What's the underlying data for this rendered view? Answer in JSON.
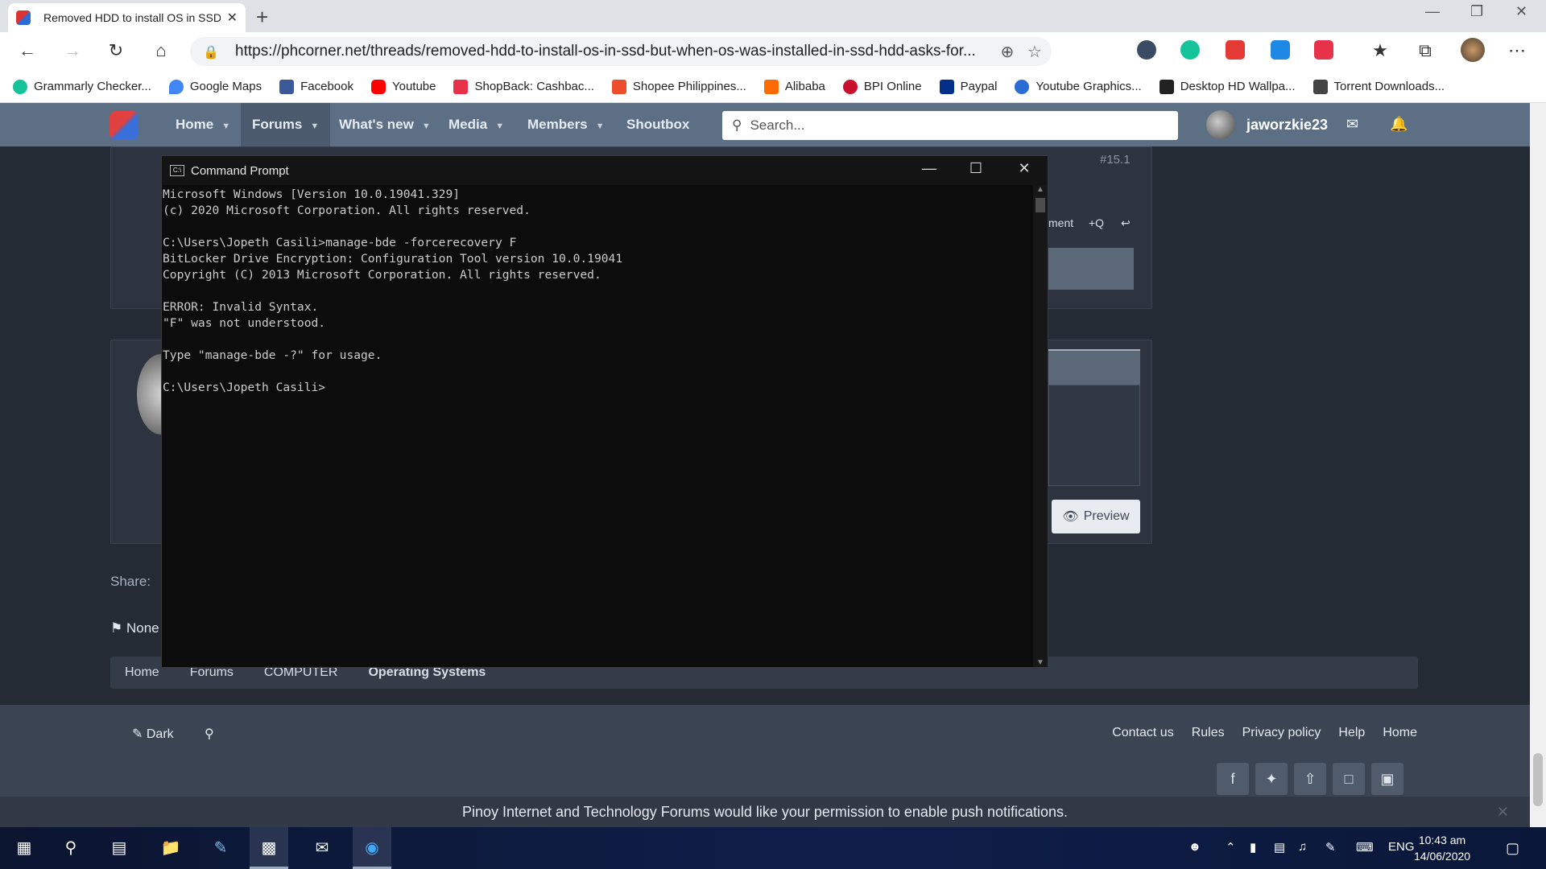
{
  "browser": {
    "tab_title": "Removed HDD to install OS in SSD but when OS was installed in SSD HDD asks for...",
    "tab_close": "✕",
    "new_tab": "+",
    "url": "https://phcorner.net/threads/removed-hdd-to-install-os-in-ssd-but-when-os-was-installed-in-ssd-hdd-asks-for...",
    "bookmarks": [
      {
        "label": "Grammarly Checker...",
        "color": "#15c39a"
      },
      {
        "label": "Google Maps",
        "color": "#4285f4"
      },
      {
        "label": "Facebook",
        "color": "#3b5998"
      },
      {
        "label": "Youtube",
        "color": "#ff0000"
      },
      {
        "label": "ShopBack: Cashbac...",
        "color": "#e8324a"
      },
      {
        "label": "Shopee Philippines...",
        "color": "#ee4d2d"
      },
      {
        "label": "Alibaba",
        "color": "#ff6a00"
      },
      {
        "label": "BPI Online",
        "color": "#c8102e"
      },
      {
        "label": "Paypal",
        "color": "#003087"
      },
      {
        "label": "Youtube Graphics...",
        "color": "#2b6cd4"
      },
      {
        "label": "Desktop HD Wallpa...",
        "color": "#222222"
      },
      {
        "label": "Torrent Downloads...",
        "color": "#444444"
      }
    ]
  },
  "site": {
    "nav": [
      "Home",
      "Forums",
      "What's new",
      "Media",
      "Members",
      "Shoutbox"
    ],
    "search_placeholder": "Search...",
    "username": "jaworzkie23",
    "post_number": "#15.1",
    "react_comment": "ment",
    "react_quote": "+Q",
    "preview_label": "Preview",
    "share_label": "Share:",
    "tags_label": "None",
    "breadcrumbs": [
      "Home",
      "Forums",
      "COMPUTER",
      "Operating Systems"
    ],
    "footer_dark": "Dark",
    "footer_links": [
      "Contact us",
      "Rules",
      "Privacy policy",
      "Help",
      "Home"
    ],
    "push_notice": "Pinoy Internet and Technology Forums would like your permission to enable push notifications.",
    "accent": "#5d6f84"
  },
  "cmd": {
    "title": "Command Prompt",
    "lines": "Microsoft Windows [Version 10.0.19041.329]\n(c) 2020 Microsoft Corporation. All rights reserved.\n\nC:\\Users\\Jopeth Casili>manage-bde -forcerecovery F\nBitLocker Drive Encryption: Configuration Tool version 10.0.19041\nCopyright (C) 2013 Microsoft Corporation. All rights reserved.\n\nERROR: Invalid Syntax.\n\"F\" was not understood.\n\nType \"manage-bde -?\" for usage.\n\nC:\\Users\\Jopeth Casili>"
  },
  "taskbar": {
    "language": "ENG",
    "time": "10:43 am",
    "date": "14/06/2020"
  }
}
